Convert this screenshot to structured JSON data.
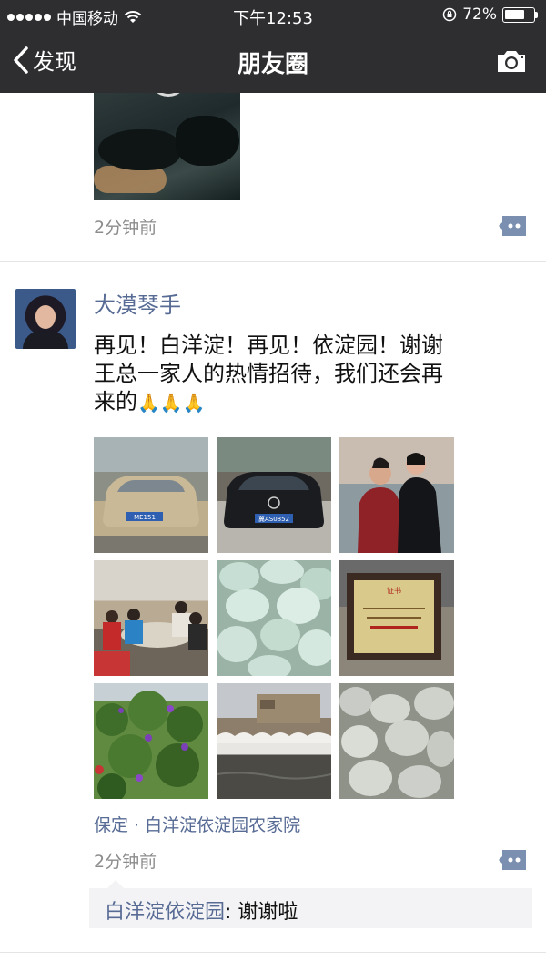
{
  "status_bar": {
    "carrier": "中国移动",
    "time": "下午12:53",
    "battery_percent": "72%",
    "battery_level": 0.72
  },
  "nav": {
    "back_label": "发现",
    "title": "朋友圈",
    "camera_icon": "camera-icon"
  },
  "post_previous": {
    "time": "2分钟前"
  },
  "post": {
    "username": "大漠琴手",
    "text_line1": "再见！白洋淀！再见！依淀园！谢谢",
    "text_line2": "王总一家人的热情招待，我们还会再",
    "text_line3": "来的",
    "emoji": "🙏🙏🙏",
    "location": "保定 · 白洋淀依淀园农家院",
    "time": "2分钟前",
    "photos": [
      "car-photo-1",
      "car-photo-2",
      "women-photo",
      "dinner-photo",
      "eggs-photo-1",
      "certificate-photo",
      "flowers-photo",
      "wall-river-photo",
      "eggs-photo-2"
    ],
    "plate_1": "ME151",
    "plate_2": "冀AS0852",
    "certificate_title": "证书",
    "comments": [
      {
        "user": "白洋淀依淀园",
        "separator": ": ",
        "text": "谢谢啦"
      }
    ]
  },
  "colors": {
    "topbar": "#2e2e31",
    "link": "#576b95",
    "meta": "#8c8c8c",
    "comment_bg": "#f3f3f5"
  }
}
